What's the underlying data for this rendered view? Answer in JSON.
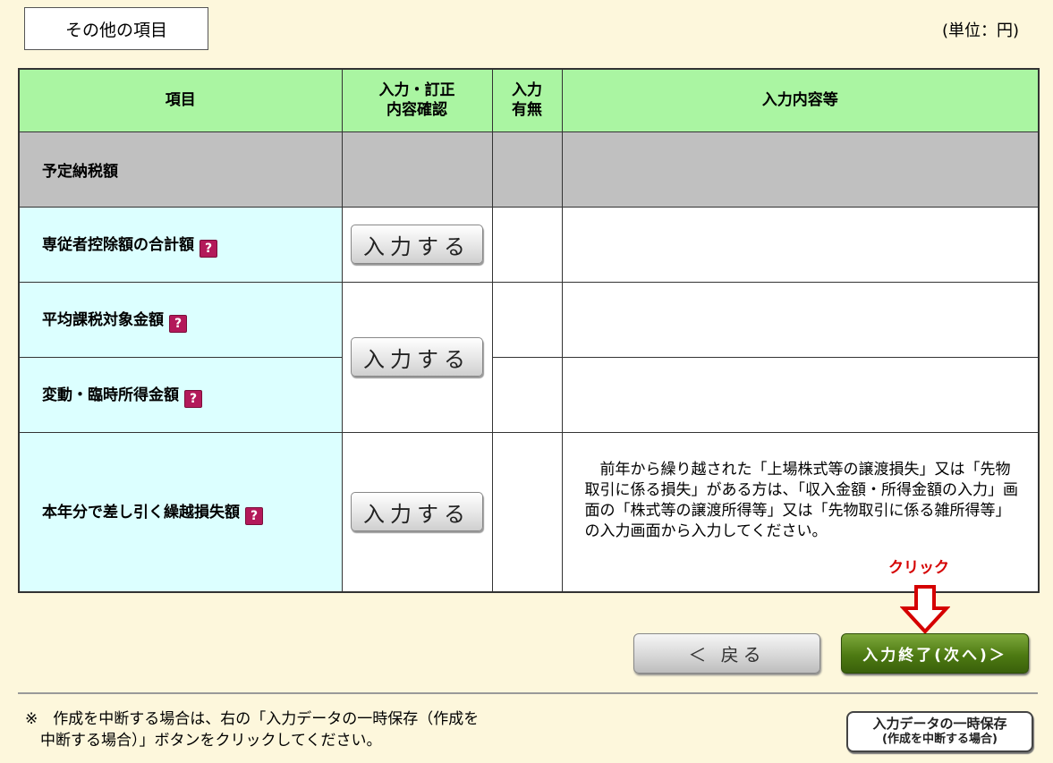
{
  "section_title": "その他の項目",
  "unit": "(単位：円)",
  "table": {
    "headers": {
      "item": "項目",
      "confirm_line1": "入力・訂正",
      "confirm_line2": "内容確認",
      "present_line1": "入力",
      "present_line2": "有無",
      "content": "入力内容等"
    },
    "rows": [
      {
        "label": "予定納税額"
      },
      {
        "label": "専従者控除額の合計額"
      },
      {
        "label": "平均課税対象金額"
      },
      {
        "label": "変動・臨時所得金額"
      },
      {
        "label": "本年分で差し引く繰越損失額"
      }
    ],
    "input_button_label": "入力する",
    "help_glyph": "?",
    "carryover_note": "前年から繰り越された「上場株式等の譲渡損失」又は「先物取引に係る損失」がある方は、「収入金額・所得金額の入力」画面の「株式等の譲渡所得等」又は「先物取引に係る雑所得等」の入力画面から入力してください。"
  },
  "annotation": {
    "click_label": "クリック",
    "arrow_color": "#d50000"
  },
  "buttons": {
    "back": "＜ 戻る",
    "next": "入力終了(次へ)＞",
    "save_line1": "入力データの一時保存",
    "save_line2": "(作成を中断する場合)"
  },
  "footer": {
    "note_line1": "※　作成を中断する場合は、右の「入力データの一時保存（作成を",
    "note_line2": "　中断する場合）」ボタンをクリックしてください。"
  },
  "colors": {
    "background": "#fdf7dc",
    "header_green": "#aaf5a2",
    "label_cyan": "#dcffff",
    "gray_row": "#c0c0c0",
    "next_green": "#4d7a12"
  }
}
